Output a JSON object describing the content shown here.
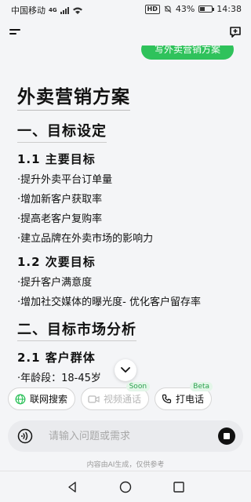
{
  "status_bar": {
    "carrier": "中国移动",
    "network": "4G",
    "battery": "43%",
    "battery_level": 0.43,
    "time": "14:38",
    "hd_badge": "HD"
  },
  "header": {
    "menu_icon": "menu-icon",
    "new_chat_icon": "new-chat-icon"
  },
  "message": {
    "prev_bubble_text": "写外卖营销方案"
  },
  "document": {
    "title": "外卖营销方案",
    "section1": {
      "heading": "一、目标设定",
      "sub1": {
        "heading": "1.1  主要目标",
        "items": [
          "·提升外卖平台订单量",
          "·增加新客户获取率",
          "·提高老客户复购率",
          "·建立品牌在外卖市场的影响力"
        ]
      },
      "sub2": {
        "heading": "1.2  次要目标",
        "items": [
          "·提升客户满意度",
          "·增加社交媒体的曝光度-  优化客户留存率"
        ]
      }
    },
    "section2": {
      "heading": "二、目标市场分析",
      "sub1": {
        "heading": "2.1  客户群体",
        "items": [
          "·年龄段：18-45岁"
        ]
      }
    }
  },
  "chips": [
    {
      "label": "联网搜索",
      "icon": "globe-icon",
      "badge": "",
      "enabled": true
    },
    {
      "label": "视频通话",
      "icon": "video-icon",
      "badge": "Soon",
      "enabled": false
    },
    {
      "label": "打电话",
      "icon": "phone-icon",
      "badge": "Beta",
      "enabled": true
    }
  ],
  "input": {
    "placeholder": "请输入问题或需求",
    "value": ""
  },
  "footer": {
    "disclaimer": "内容由AI生成，仅供参考"
  },
  "colors": {
    "accent": "#2fc25b",
    "badge_text": "#2aa04d",
    "background": "#f4f5f7"
  }
}
